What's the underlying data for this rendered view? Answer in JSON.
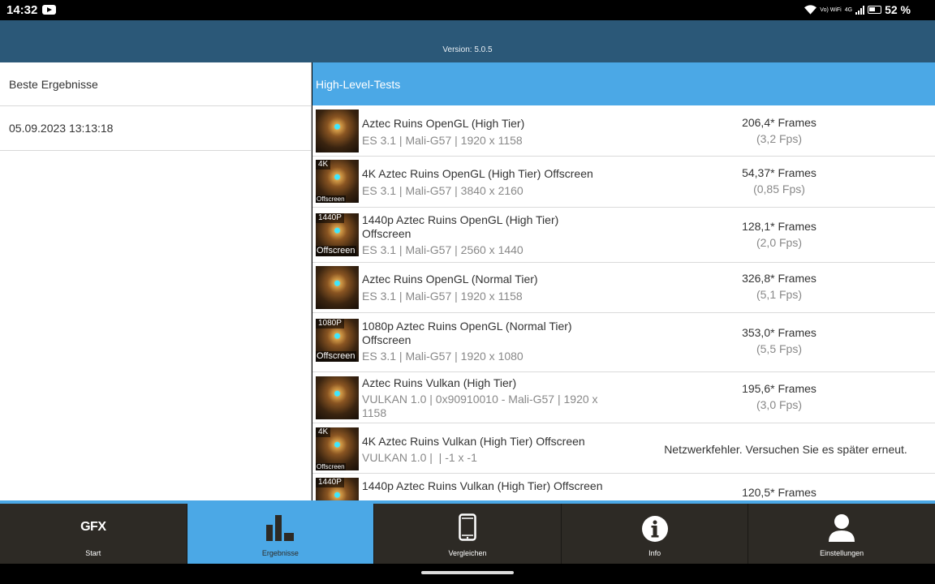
{
  "status_bar": {
    "time": "14:32",
    "wifi_label": "Vo) WiFi",
    "network": "4G",
    "battery": "52 %"
  },
  "header": {
    "version": "Version: 5.0.5"
  },
  "left_pane": {
    "title": "Beste Ergebnisse",
    "results": [
      "05.09.2023 13:13:18"
    ]
  },
  "right_pane": {
    "title": "High-Level-Tests",
    "tests": [
      {
        "name": "Aztec Ruins OpenGL (High Tier)",
        "details": "ES 3.1 | Mali-G57 | 1920 x 1158",
        "score": "206,4* Frames",
        "fps": "(3,2 Fps)",
        "thumb_top": "",
        "thumb_bottom": ""
      },
      {
        "name": "4K Aztec Ruins OpenGL (High Tier) Offscreen",
        "details": "ES 3.1 | Mali-G57 | 3840 x 2160",
        "score": "54,37* Frames",
        "fps": "(0,85 Fps)",
        "thumb_top": "4K",
        "thumb_bottom": "Offscreen"
      },
      {
        "name": "1440p Aztec Ruins OpenGL (High Tier) Offscreen",
        "details": "ES 3.1 | Mali-G57 | 2560 x 1440",
        "score": "128,1* Frames",
        "fps": "(2,0 Fps)",
        "thumb_top": "1440P",
        "thumb_bottom": "Offscreen"
      },
      {
        "name": "Aztec Ruins OpenGL (Normal Tier)",
        "details": "ES 3.1 | Mali-G57 | 1920 x 1158",
        "score": "326,8* Frames",
        "fps": "(5,1 Fps)",
        "thumb_top": "",
        "thumb_bottom": ""
      },
      {
        "name": "1080p Aztec Ruins OpenGL (Normal Tier) Offscreen",
        "details": "ES 3.1 | Mali-G57 | 1920 x 1080",
        "score": "353,0* Frames",
        "fps": "(5,5 Fps)",
        "thumb_top": "1080P",
        "thumb_bottom": "Offscreen"
      },
      {
        "name": "Aztec Ruins Vulkan (High Tier)",
        "details": "VULKAN 1.0 | 0x90910010 - Mali-G57 | 1920 x 1158",
        "score": "195,6* Frames",
        "fps": "(3,0 Fps)",
        "thumb_top": "",
        "thumb_bottom": ""
      },
      {
        "name": "4K Aztec Ruins Vulkan (High Tier) Offscreen",
        "details": "VULKAN 1.0 |  | -1 x -1",
        "error": "Netzwerkfehler. Versuchen Sie es später erneut.",
        "thumb_top": "4K",
        "thumb_bottom": "Offscreen"
      },
      {
        "name": "1440p Aztec Ruins Vulkan (High Tier) Offscreen",
        "details": "",
        "score": "120,5* Frames",
        "fps": "",
        "thumb_top": "1440P",
        "thumb_bottom": ""
      }
    ]
  },
  "bottom_nav": {
    "items": [
      {
        "label": "Start",
        "icon": "gfx-logo",
        "logo_text": "GFX"
      },
      {
        "label": "Ergebnisse",
        "icon": "bar-chart-icon"
      },
      {
        "label": "Vergleichen",
        "icon": "phone-icon"
      },
      {
        "label": "Info",
        "icon": "info-icon"
      },
      {
        "label": "Einstellungen",
        "icon": "user-icon"
      }
    ],
    "active_index": 1
  },
  "colors": {
    "header_bg": "#2b5878",
    "accent": "#4ba8e6",
    "nav_bg": "#2d2a25"
  }
}
